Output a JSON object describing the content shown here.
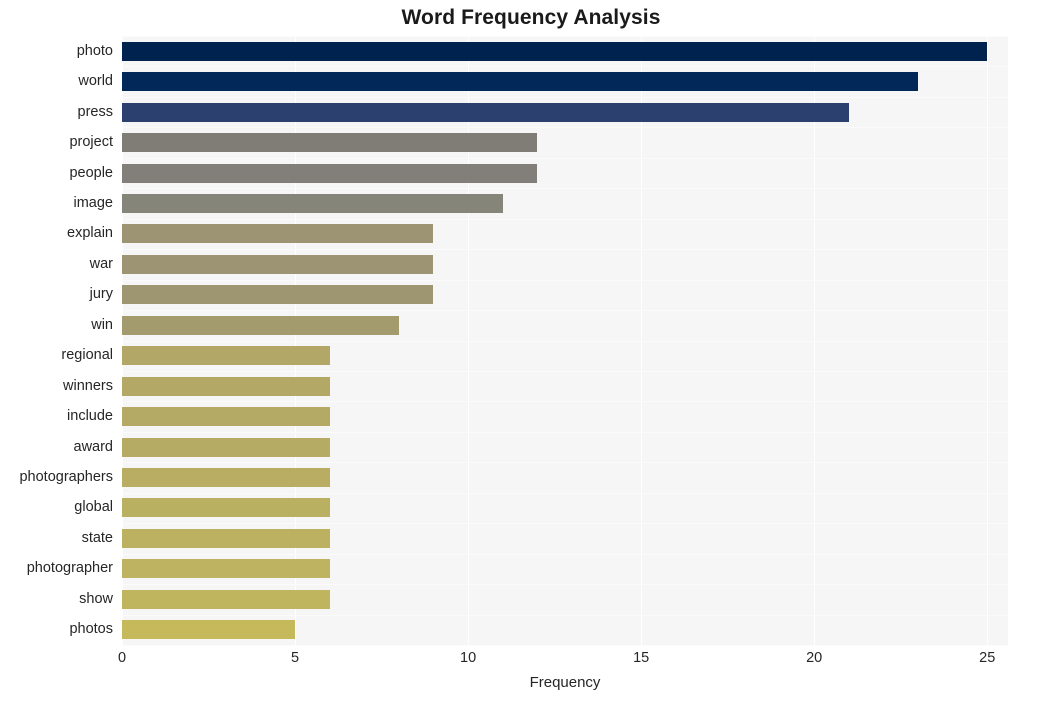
{
  "chart_data": {
    "type": "bar",
    "orientation": "horizontal",
    "title": "Word Frequency Analysis",
    "xlabel": "Frequency",
    "ylabel": "",
    "xlim": [
      0,
      25.6
    ],
    "xticks": [
      0,
      5,
      10,
      15,
      20,
      25
    ],
    "xtick_labels": [
      "0",
      "5",
      "10",
      "15",
      "20",
      "25"
    ],
    "grid": true,
    "grid_color": "#ffffff",
    "plot_background": "#f6f6f7",
    "figure_background": "#ffffff",
    "legend": "none",
    "categories": [
      "photo",
      "world",
      "press",
      "project",
      "people",
      "image",
      "explain",
      "war",
      "jury",
      "win",
      "regional",
      "winners",
      "include",
      "award",
      "photographers",
      "global",
      "state",
      "photographer",
      "show",
      "photos"
    ],
    "values": [
      25,
      23,
      21,
      12,
      12,
      11,
      9,
      9,
      9,
      8,
      6,
      6,
      6,
      6,
      6,
      6,
      6,
      6,
      6,
      5
    ],
    "bar_colors": [
      "#00224e",
      "#023濃",
      "#2b406e",
      "#7f7d76",
      "#827f7a",
      "#86857a",
      "#9c9473",
      "#9c9473",
      "#9e9671",
      "#a39a6e",
      "#b2a767",
      "#b3a866",
      "#b5aa65",
      "#b6ab64",
      "#b8ad63",
      "#bab062",
      "#bcb161",
      "#beb360",
      "#c0b55f",
      "#c5b95c"
    ],
    "series_name": "Frequency"
  },
  "axis": {
    "x_label": "Frequency"
  }
}
